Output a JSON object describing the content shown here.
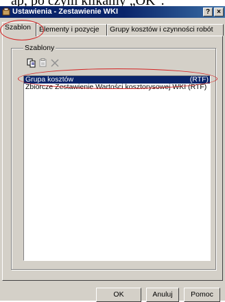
{
  "document_text": "ap, po czym klikamy „OK\".",
  "window": {
    "title": "Ustawienia - Zestawienie WKI",
    "help_label": "?",
    "close_label": "×"
  },
  "tabs": [
    {
      "label": "Szablon",
      "active": true
    },
    {
      "label": "Elementy i pozycje",
      "active": false
    },
    {
      "label": "Grupy kosztów i czynności robót",
      "active": false
    }
  ],
  "group": {
    "label": "Szablony",
    "toolbar": [
      "copy-icon",
      "properties-icon",
      "delete-icon"
    ]
  },
  "templates": [
    {
      "name": "Grupa kosztów",
      "format": "(RTF)",
      "selected": true
    },
    {
      "name": "Zbiorcze Zestawienie Wartości kosztorysowej WKI (RTF)",
      "format": "",
      "selected": false
    }
  ],
  "buttons": {
    "ok": "OK",
    "cancel": "Anuluj",
    "help": "Pomoc"
  },
  "colors": {
    "titlebar": "#0a246a",
    "selection": "#0a246a",
    "face": "#d4d0c8",
    "annotation": "#d42020"
  }
}
